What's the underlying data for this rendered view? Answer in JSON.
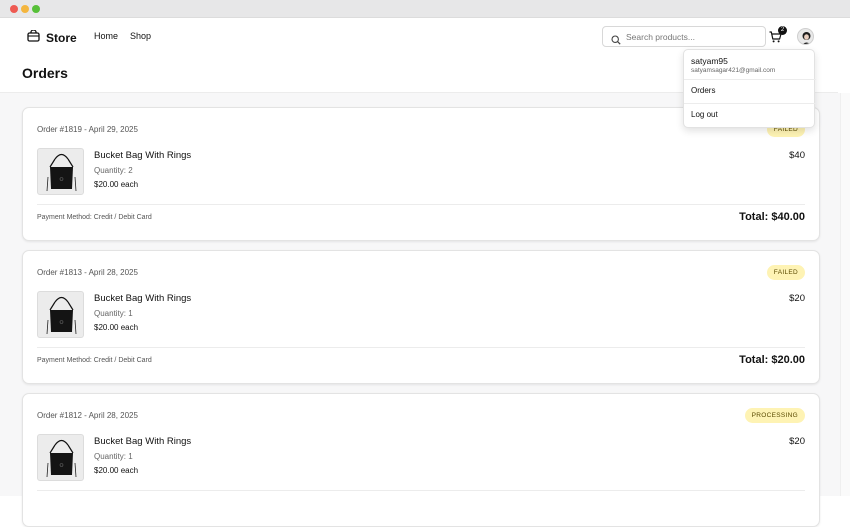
{
  "nav": {
    "brand": "Store",
    "links": [
      {
        "label": "Home"
      },
      {
        "label": "Shop"
      }
    ],
    "search_placeholder": "Search products...",
    "cart_count": "2"
  },
  "page": {
    "title": "Orders"
  },
  "dropdown": {
    "username": "satyam95",
    "email": "satyamsagar421@gmail.com",
    "items": [
      {
        "label": "Orders"
      },
      {
        "label": "Log out"
      }
    ]
  },
  "orders": [
    {
      "header": "Order #1819 - April 29, 2025",
      "status": "FAILED",
      "item_name": "Bucket Bag With Rings",
      "quantity": "Quantity: 2",
      "unit_price": "$20.00 each",
      "line_total": "$40",
      "payment": "Payment Method: Credit / Debit Card",
      "total": "Total: $40.00"
    },
    {
      "header": "Order #1813 - April 28, 2025",
      "status": "FAILED",
      "item_name": "Bucket Bag With Rings",
      "quantity": "Quantity: 1",
      "unit_price": "$20.00 each",
      "line_total": "$20",
      "payment": "Payment Method: Credit / Debit Card",
      "total": "Total: $20.00"
    },
    {
      "header": "Order #1812 - April 28, 2025",
      "status": "PROCESSING",
      "item_name": "Bucket Bag With Rings",
      "quantity": "Quantity: 1",
      "unit_price": "$20.00 each",
      "line_total": "$20"
    }
  ],
  "colors": {
    "badge_bg": "#fef3b4",
    "accent": "#111111"
  }
}
